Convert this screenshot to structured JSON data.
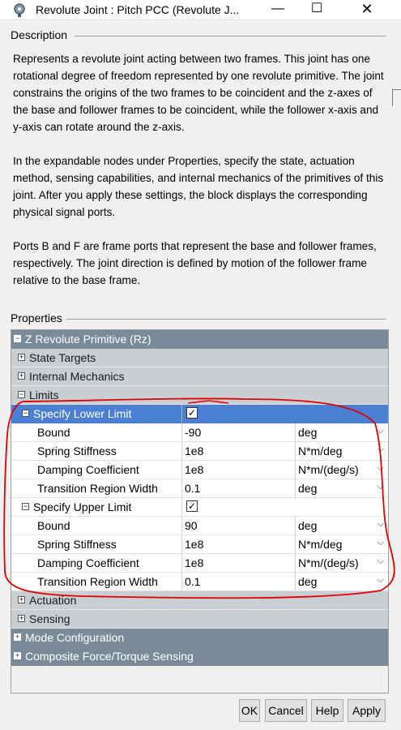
{
  "window": {
    "title": "Revolute Joint : Pitch PCC  (Revolute J...",
    "minimize_glyph": "—",
    "maximize_glyph": "☐",
    "close_glyph": "✕"
  },
  "description": {
    "legend": "Description",
    "paragraphs": [
      "Represents a revolute joint acting between two frames. This joint has one rotational degree of freedom represented by one revolute primitive. The joint constrains the origins of the two frames to be coincident and the z-axes of the base and follower frames to be coincident, while the follower x-axis and y-axis can rotate around the z-axis.",
      "In the expandable nodes under Properties, specify the state, actuation method, sensing capabilities, and internal mechanics of the primitives of this joint. After you apply these settings, the block displays the corresponding physical signal ports.",
      "Ports B and F are frame ports that represent the base and follower frames, respectively. The joint direction is defined by motion of the follower frame relative to the base frame."
    ]
  },
  "properties": {
    "legend": "Properties",
    "z_primitive": "Z Revolute Primitive (Rz)",
    "state_targets": "State Targets",
    "internal_mechanics": "Internal Mechanics",
    "limits": "Limits",
    "lower": {
      "label": "Specify Lower Limit",
      "checked": true,
      "rows": [
        {
          "name": "Bound",
          "value": "-90",
          "unit": "deg"
        },
        {
          "name": "Spring Stiffness",
          "value": "1e8",
          "unit": "N*m/deg"
        },
        {
          "name": "Damping Coefficient",
          "value": "1e8",
          "unit": "N*m/(deg/s)"
        },
        {
          "name": "Transition Region Width",
          "value": "0.1",
          "unit": "deg"
        }
      ]
    },
    "upper": {
      "label": "Specify Upper Limit",
      "checked": true,
      "rows": [
        {
          "name": "Bound",
          "value": "90",
          "unit": "deg"
        },
        {
          "name": "Spring Stiffness",
          "value": "1e8",
          "unit": "N*m/deg"
        },
        {
          "name": "Damping Coefficient",
          "value": "1e8",
          "unit": "N*m/(deg/s)"
        },
        {
          "name": "Transition Region Width",
          "value": "0.1",
          "unit": "deg"
        }
      ]
    },
    "actuation": "Actuation",
    "sensing": "Sensing",
    "mode_configuration": "Mode Configuration",
    "composite_sensing": "Composite Force/Torque Sensing"
  },
  "buttons": {
    "ok": "OK",
    "cancel": "Cancel",
    "help": "Help",
    "apply": "Apply"
  },
  "colors": {
    "group_header": "#7a8a98",
    "sub_header": "#c9ced3",
    "selection": "#4a7fd4",
    "annotation": "#e00000"
  }
}
